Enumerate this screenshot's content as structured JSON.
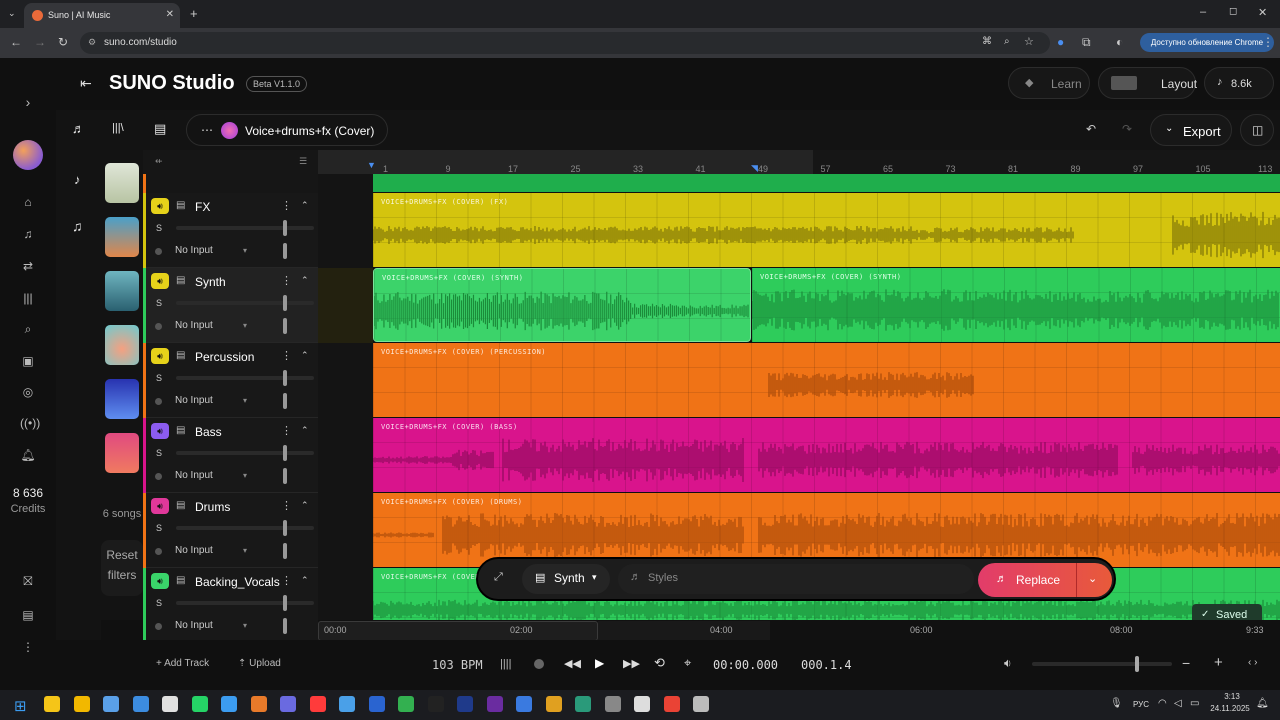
{
  "browser": {
    "tab_title": "Suno | AI Music",
    "url": "suno.com/studio",
    "update_label": "Доступно обновление Chrome"
  },
  "app": {
    "logo": "SUNO Studio",
    "version": "Beta V1.1.0",
    "learn": "Learn",
    "layout": "Layout",
    "plays": "8.6k",
    "project": "Voice+drums+fx (Cover)",
    "export": "Export"
  },
  "sidebar": {
    "credits_value": "8 636",
    "credits_label": "Credits"
  },
  "library": {
    "songs": "6 songs",
    "reset": "Reset",
    "filters": "filters"
  },
  "tracks": [
    {
      "name": "FX",
      "color": "#d4c40e",
      "mute_color": "#e6d21a",
      "clip": "VOICE+DRUMS+FX (COVER) (FX)",
      "input": "No Input",
      "s": "S"
    },
    {
      "name": "Synth",
      "color": "#2ecc5b",
      "mute_color": "#e6d21a",
      "clip": "VOICE+DRUMS+FX (COVER) (SYNTH)",
      "clip2": "VOICE+DRUMS+FX (COVER) (SYNTH)",
      "input": "No Input",
      "s": "S"
    },
    {
      "name": "Percussion",
      "color": "#f07316",
      "mute_color": "#e6d21a",
      "clip": "VOICE+DRUMS+FX (COVER) (PERCUSSION)",
      "input": "No Input",
      "s": "S"
    },
    {
      "name": "Bass",
      "color": "#d9148c",
      "mute_color": "#8c5cf0",
      "clip": "VOICE+DRUMS+FX (COVER) (BASS)",
      "input": "No Input",
      "s": "S"
    },
    {
      "name": "Drums",
      "color": "#f07316",
      "mute_color": "#e0389a",
      "clip": "VOICE+DRUMS+FX (COVER) (DRUMS)",
      "input": "No Input",
      "s": "S"
    },
    {
      "name": "Backing_Vocals",
      "color": "#2ecc5b",
      "mute_color": "#3ad46a",
      "clip": "VOICE+DRUMS+FX (COVER) (",
      "input": "No Input",
      "s": "S"
    }
  ],
  "ruler": [
    "1",
    "9",
    "17",
    "25",
    "33",
    "41",
    "49",
    "57",
    "65",
    "73",
    "81",
    "89",
    "97",
    "105",
    "113"
  ],
  "timebar": [
    "00:00",
    "02:00",
    "04:00",
    "06:00",
    "08:00",
    "9:33"
  ],
  "floating": {
    "track": "Synth",
    "styles_placeholder": "Styles",
    "replace": "Replace"
  },
  "saved": "Saved",
  "transport": {
    "add_track": "Add Track",
    "upload": "Upload",
    "bpm": "103 BPM",
    "time": "00:00.000",
    "bar": "000.1.4"
  },
  "taskbar": {
    "lang": "РУС",
    "time": "3:13",
    "date": "24.11.2025"
  }
}
